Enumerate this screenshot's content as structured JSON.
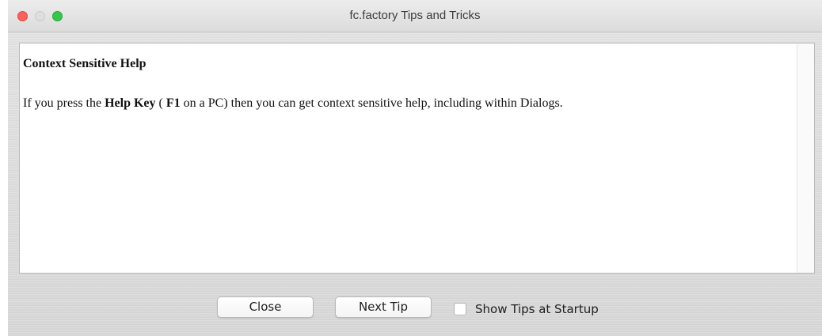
{
  "window": {
    "title": "fc.factory Tips and Tricks"
  },
  "tip": {
    "heading": "Context Sensitive Help",
    "text_prefix": "If you press the ",
    "help_key": "Help Key",
    "text_paren_open": " ( ",
    "f1_key": "F1",
    "text_suffix": " on a PC) then you can get context sensitive help, including within Dialogs."
  },
  "buttons": {
    "close_label": "Close",
    "next_tip_label": "Next Tip"
  },
  "startup_option": {
    "label": "Show Tips at Startup",
    "checked": false
  },
  "colors": {
    "traffic_close": "#fc605c",
    "traffic_minimize": "#dedede",
    "traffic_zoom": "#34c84a"
  }
}
